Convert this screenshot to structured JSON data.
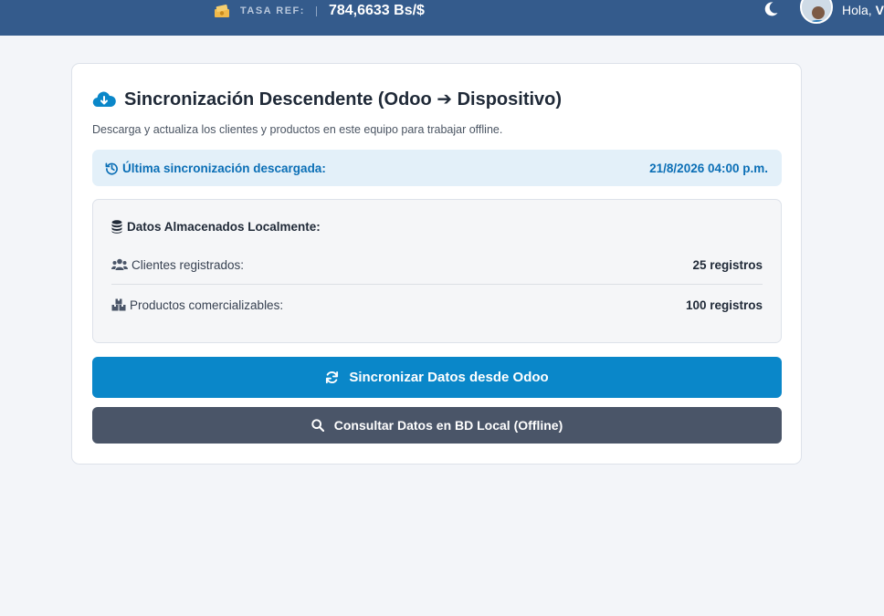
{
  "header": {
    "rate_label": "TASA REF:",
    "rate_value": "784,6633 Bs/$",
    "greeting": "Hola,",
    "user_name": "V"
  },
  "sync_card": {
    "title": "Sincronización Descendente (Odoo ➔ Dispositivo)",
    "subtitle": "Descarga y actualiza los clientes y productos en este equipo para trabajar offline.",
    "last_sync_label": "Última sincronización descargada:",
    "last_sync_value": "21/8/2026 04:00 p.m.",
    "local_data_title": "Datos Almacenados Localmente:",
    "rows": [
      {
        "label": "Clientes registrados:",
        "count": "25 registros"
      },
      {
        "label": "Productos comercializables:",
        "count": "100 registros"
      }
    ],
    "sync_button_label": "Sincronizar Datos desde Odoo",
    "local_button_label": "Consultar Datos en BD Local (Offline)"
  },
  "colors": {
    "topbar": "#345b8c",
    "accent": "#0a87c9",
    "secondary_button": "#4a5568",
    "info_background": "#e3f0f9",
    "info_text": "#0b6fb6"
  },
  "icons": {
    "rate": "money-bill-icon",
    "theme": "moon-icon",
    "title": "cloud-download-icon",
    "last_sync": "history-icon",
    "local_data": "database-icon",
    "clients": "users-icon",
    "products": "boxes-icon",
    "sync_button": "sync-icon",
    "local_button": "search-icon"
  }
}
